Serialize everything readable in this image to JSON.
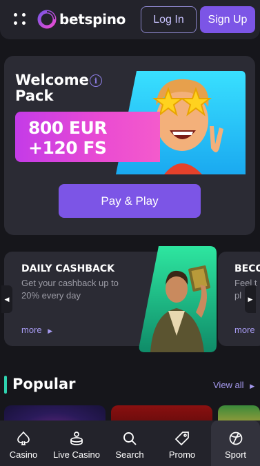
{
  "header": {
    "brand": "betspino",
    "login_label": "Log In",
    "signup_label": "Sign Up"
  },
  "welcome": {
    "title": "Welcome Pack",
    "bonus_line1": "800 EUR",
    "bonus_line2": "+120 FS",
    "cta_label": "Pay & Play"
  },
  "promos": [
    {
      "title": "DAILY CASHBACK",
      "description": "Get your cashback up to 20% every day",
      "more_label": "more"
    },
    {
      "title": "BECO",
      "description_line1": "Feel t",
      "description_line2": "pl",
      "more_label": "more"
    }
  ],
  "popular": {
    "title": "Popular",
    "view_all_label": "View all"
  },
  "bottom_nav": [
    {
      "label": "Casino",
      "icon": "spade-icon"
    },
    {
      "label": "Live Casino",
      "icon": "dealer-icon"
    },
    {
      "label": "Search",
      "icon": "search-icon"
    },
    {
      "label": "Promo",
      "icon": "tag-icon"
    },
    {
      "label": "Sport",
      "icon": "ball-icon"
    }
  ],
  "colors": {
    "accent": "#7c55e6",
    "popular_marker": "#2fd3b0",
    "link": "#a69af0"
  }
}
